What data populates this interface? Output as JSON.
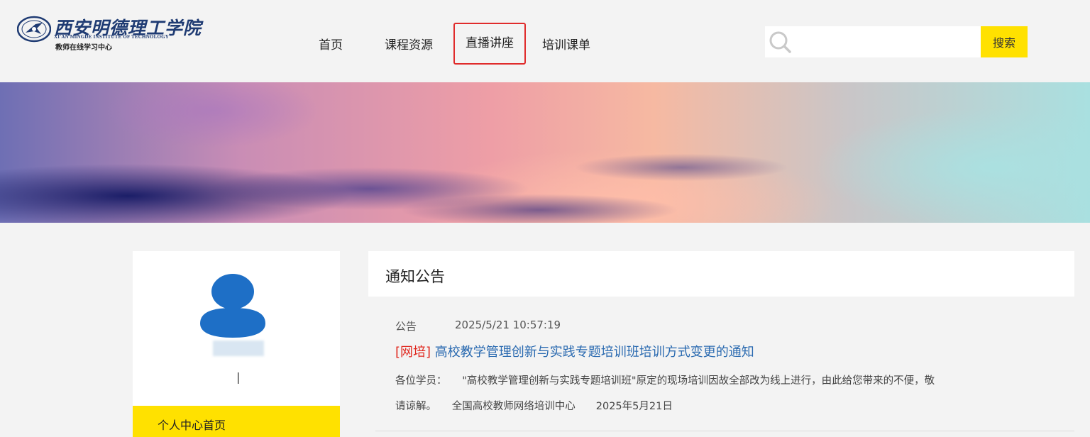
{
  "header": {
    "logo": {
      "name_cn": "西安明德理工学院",
      "name_en": "XI'AN MINGDE INSTITUTE OF TECHNOLOGY",
      "subtitle": "教师在线学习中心",
      "brand_color": "#1f3b73"
    },
    "nav": {
      "items": [
        {
          "label": "首页"
        },
        {
          "label": "课程资源"
        },
        {
          "label": "直播讲座",
          "highlighted": true
        },
        {
          "label": "培训课单"
        }
      ],
      "highlight_color": "#e02b2b"
    },
    "search": {
      "placeholder": "",
      "value": "",
      "button_label": "搜索",
      "button_color": "#ffe100",
      "icon": "search-icon"
    }
  },
  "profile": {
    "avatar_icon": "user-avatar-icon",
    "avatar_color": "#1e6fc6",
    "separator": "|",
    "menu": [
      {
        "label": "个人中心首页",
        "active": true
      }
    ],
    "menu_active_color": "#ffe100"
  },
  "notices": {
    "title": "通知公告",
    "items": [
      {
        "type": "公告",
        "time": "2025/5/21 10:57:19",
        "tag": "[网培]",
        "headline": "高校教学管理创新与实践专题培训班培训方式变更的通知",
        "body_line1": "各位学员：　　\"高校教学管理创新与实践专题培训班\"原定的现场培训因故全部改为线上进行，由此给您带来的不便，敬",
        "body_line2": "请谅解。　　全国高校教师网络培训中心　　2025年5月21日",
        "tag_color": "#e0261d",
        "headline_color": "#2a6ab0"
      }
    ]
  }
}
